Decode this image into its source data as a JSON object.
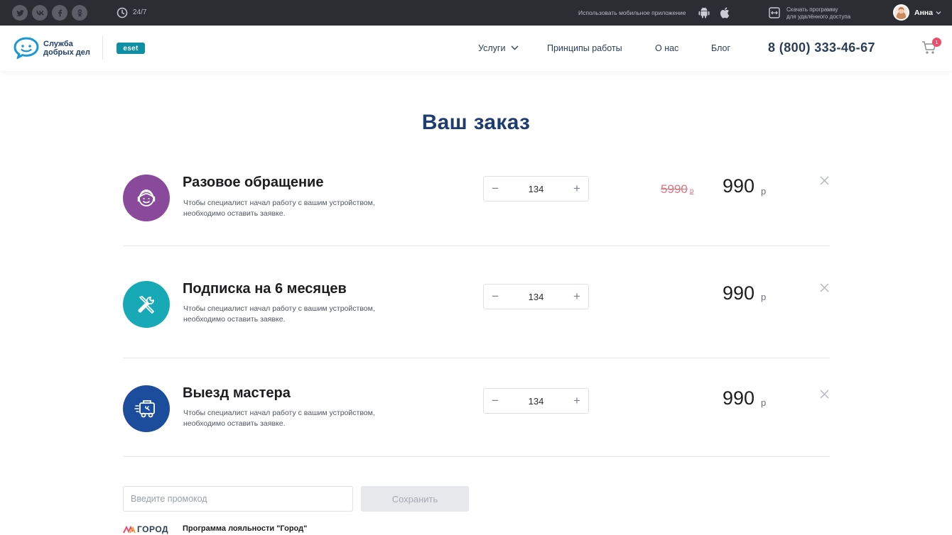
{
  "topbar": {
    "support_hours": "24/7",
    "mobile_app_text": "Использовать мобильное приложение",
    "remote_line1": "Скачать программу",
    "remote_line2": "для удалённого доступа",
    "user_name": "Анна"
  },
  "header": {
    "logo_line1": "Служба",
    "logo_line2": "добрых дел",
    "partner_logo": "eset",
    "nav": {
      "services": "Услуги",
      "principles": "Принципы работы",
      "about": "О нас",
      "blog": "Блог"
    },
    "phone": "8 (800) 333-46-67",
    "cart_count": "1"
  },
  "page_title": "Ваш заказ",
  "order_items": [
    {
      "name": "Разовое обращение",
      "desc_line1": "Чтобы специалист начал работу с вашим устройством,",
      "desc_line2": "необходимо оставить заявке.",
      "quantity": "134",
      "old_price": "5990",
      "old_currency": "р",
      "price": "990",
      "currency": "р",
      "icon": "operator-headset-icon",
      "icon_color": "#8a4a9c"
    },
    {
      "name": "Подписка на 6 месяцев",
      "desc_line1": "Чтобы специалист начал работу с вашим устройством,",
      "desc_line2": "необходимо оставить заявке.",
      "quantity": "134",
      "price": "990",
      "currency": "р",
      "icon": "tools-icon",
      "icon_color": "#17a9b5"
    },
    {
      "name": "Выезд мастера",
      "desc_line1": "Чтобы специалист начал работу с вашим устройством,",
      "desc_line2": "необходимо оставить заявке.",
      "quantity": "134",
      "price": "990",
      "currency": "р",
      "icon": "service-van-icon",
      "icon_color": "#1c4c9c"
    }
  ],
  "promo": {
    "placeholder": "Введите промокод",
    "save_label": "Сохранить"
  },
  "loyalty": {
    "logo_text": "ГОРОД",
    "title": "Программа лояльности \"Город\""
  },
  "colors": {
    "topbar_bg": "#2b2d33",
    "title": "#1f3c6e",
    "old_price": "#e07580",
    "cart_badge": "#e8506c"
  }
}
